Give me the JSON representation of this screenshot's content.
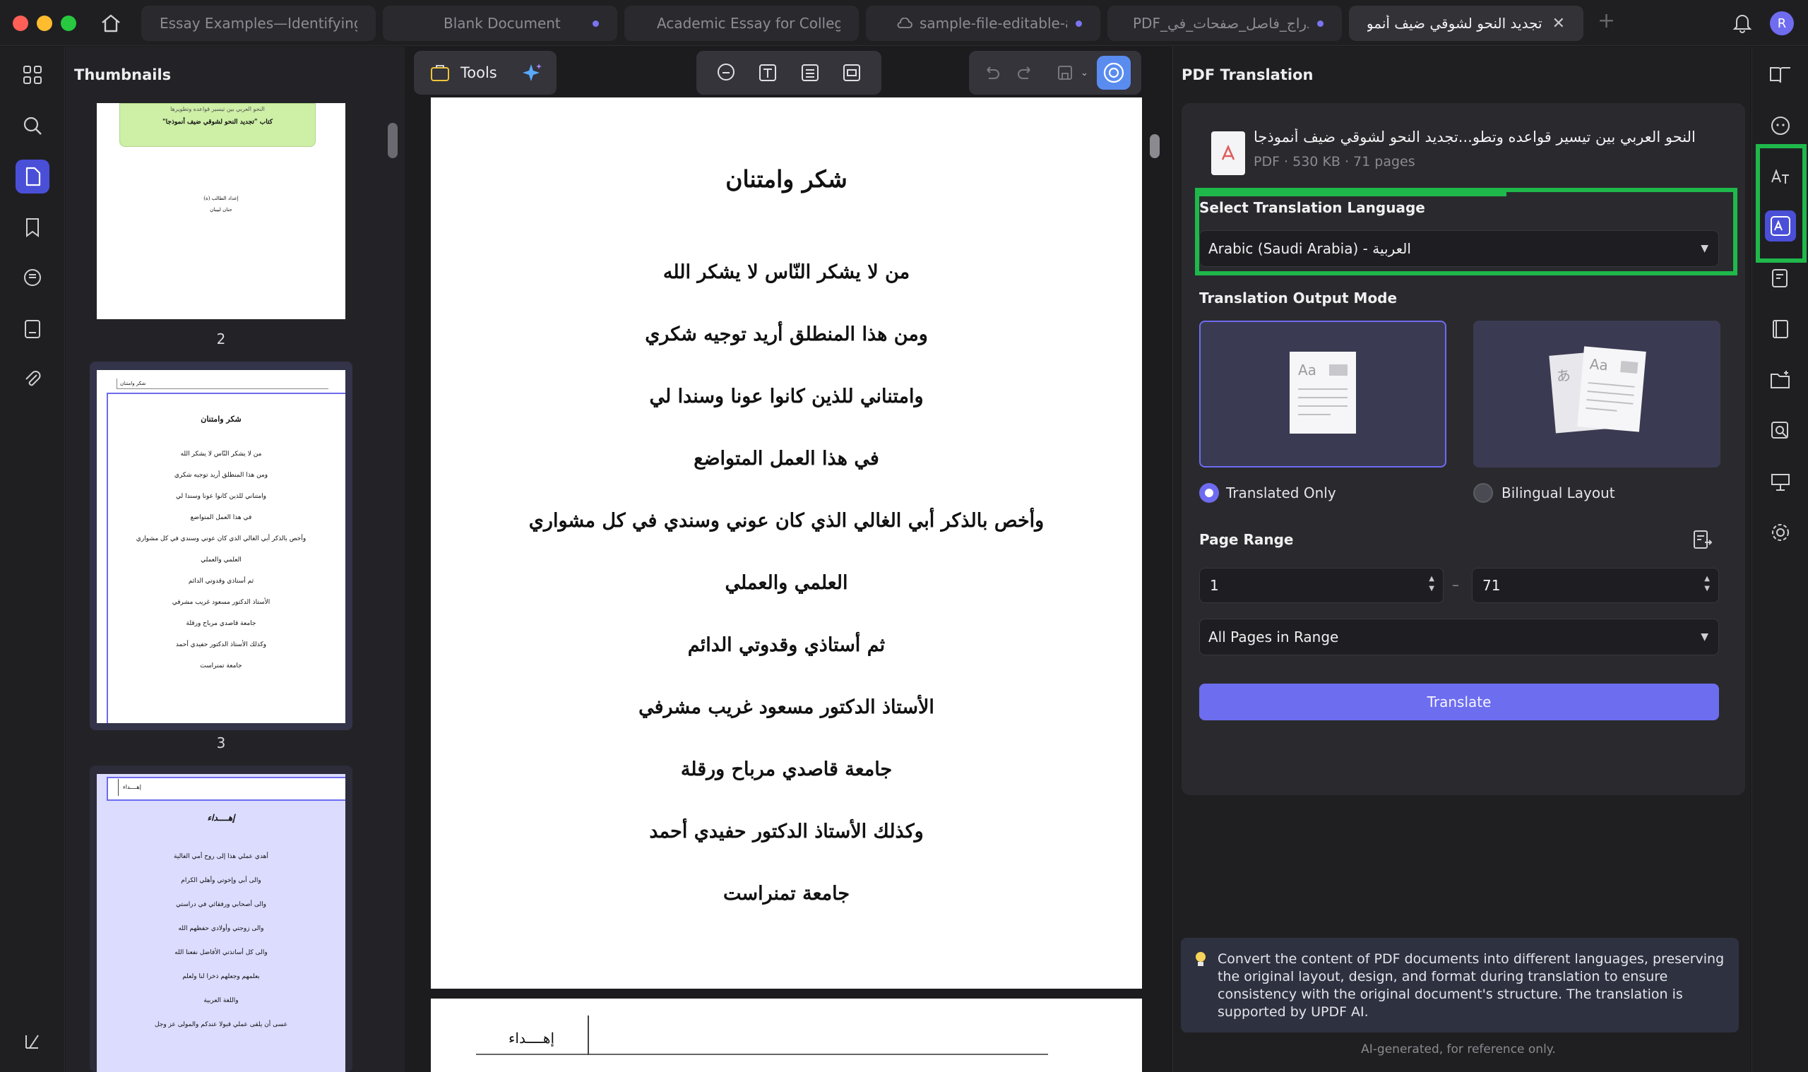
{
  "tabs": [
    {
      "label": "Essay Examples—Identifying",
      "dot": false
    },
    {
      "label": "Blank Document",
      "dot": true
    },
    {
      "label": "Academic Essay for College",
      "dot": false
    },
    {
      "label": "sample-file-editable-and",
      "dot": true
    },
    {
      "label": "PDF_إدراج_فاصل_صفحات_في",
      "dot": true
    },
    {
      "label": "تجديد النحو لشوقي ضيف أنموذجا",
      "active": true
    }
  ],
  "user": {
    "avatar_initial": "R"
  },
  "thumbnails": {
    "title": "Thumbnails",
    "page2_num": "2",
    "page2_banner_line1": "النحو العربي بين تيسير قواعده وتطويرها",
    "page2_banner_line2": "كتاب \"تجديد النحو لشوقي ضيف أنموذجا\"",
    "page2_author_line1": "إعداد الطالب (ة)",
    "page2_author_line2": "حنان لبيبان",
    "page3_num": "3",
    "page3_header": "شكر وامتنان",
    "page3_title": "شكر وامتنان",
    "page3_lines": [
      "من لا يشكر النّاس لا يشكر الله",
      "ومن هذا المنطلق أريد توجيه شكري",
      "وامتناني للذين كانوا عونا وسندا لي",
      "في هذا العمل المتواضع",
      "وأخص بالذكر أبي الغالي الذي كان عوني وسندي في كل مشواري",
      "العلمي والعملي",
      "ثم أستاذي وقدوتي الدائم",
      "الأستاذ الدكتور مسعود غريب مشرفي",
      "جامعة قاصدي مرباح ورقلة",
      "وكذلك الأستاذ الدكتور حفيدي أحمد",
      "جامعة تمنراست"
    ],
    "page4_header": "إهــــداء",
    "page4_title": "إهــــداء",
    "page4_lines": [
      "أهدي عملي هذا إلى روح أمي الغالية",
      "والى أبي وإخوتي وأهلي الكرام",
      "والى أصحابي ورفقائي في دراستي",
      "والى زوجتي وأولادي حفظهم الله",
      "والى كل أساتذتي الأفاضل نفعنا الله",
      "بعلمهم وجعلهم ذخرا لنا ولعلم",
      "واللغة العربية",
      "عسى أن يلقى عملي قبولا عندكم والمولى عز وجل"
    ]
  },
  "toolbar": {
    "tools_label": "Tools"
  },
  "document": {
    "title": "شكر وامتنان",
    "lines": [
      "من لا يشكر النّاس لا يشكر الله",
      "ومن هذا المنطلق أريد توجيه شكري",
      "وامتناني للذين كانوا عونا وسندا لي",
      "في هذا العمل المتواضع",
      "وأخص بالذكر أبي الغالي الذي كان عوني وسندي في كل مشواري",
      "العلمي والعملي",
      "ثم أستاذي وقدوتي الدائم",
      "الأستاذ الدكتور مسعود غريب مشرفي",
      "جامعة قاصدي مرباح ورقلة",
      "وكذلك الأستاذ الدكتور حفيدي أحمد",
      "جامعة تمنراست"
    ],
    "next_page_header": "إهــــداء"
  },
  "translation": {
    "panel_title": "PDF Translation",
    "file_name": "النحو العربي بين تيسير قواعده وتطو...تجديد النحو لشوقي ضيف أنموذجا",
    "file_meta": "PDF · 530 KB · 71 pages",
    "language_label": "Select Translation Language",
    "language_value": "Arabic (Saudi Arabia) - العربية",
    "output_mode_label": "Translation Output Mode",
    "mode_translated": "Translated Only",
    "mode_bilingual": "Bilingual Layout",
    "selected_mode": "Translated Only",
    "page_range_label": "Page Range",
    "range_from": "1",
    "range_sep": "–",
    "range_to": "71",
    "range_scope": "All Pages in Range",
    "translate_button": "Translate",
    "info_text": "Convert the content of PDF documents into different languages, preserving the original layout, design, and format during translation to ensure consistency with the original document's structure. The translation is supported by UPDF AI.",
    "ai_note": "AI-generated, for reference only."
  },
  "colors": {
    "accent": "#6d6df0",
    "highlight_box": "#1fb84b",
    "active_nav": "#4a4fd8"
  },
  "icons": {
    "left_rail": [
      "apps-grid-icon",
      "search-icon",
      "pages-icon",
      "bookmark-icon",
      "comment-icon",
      "form-icon",
      "attachment-icon",
      "sidebar-toggle-icon"
    ],
    "right_rail": [
      "book-open-icon",
      "ai-assistant-icon",
      "translate-icon",
      "translate-pdf-icon",
      "ai-summarize-icon",
      "book-icon",
      "folder-plus-icon",
      "search-doc-icon",
      "presentation-icon",
      "settings-icon"
    ]
  }
}
